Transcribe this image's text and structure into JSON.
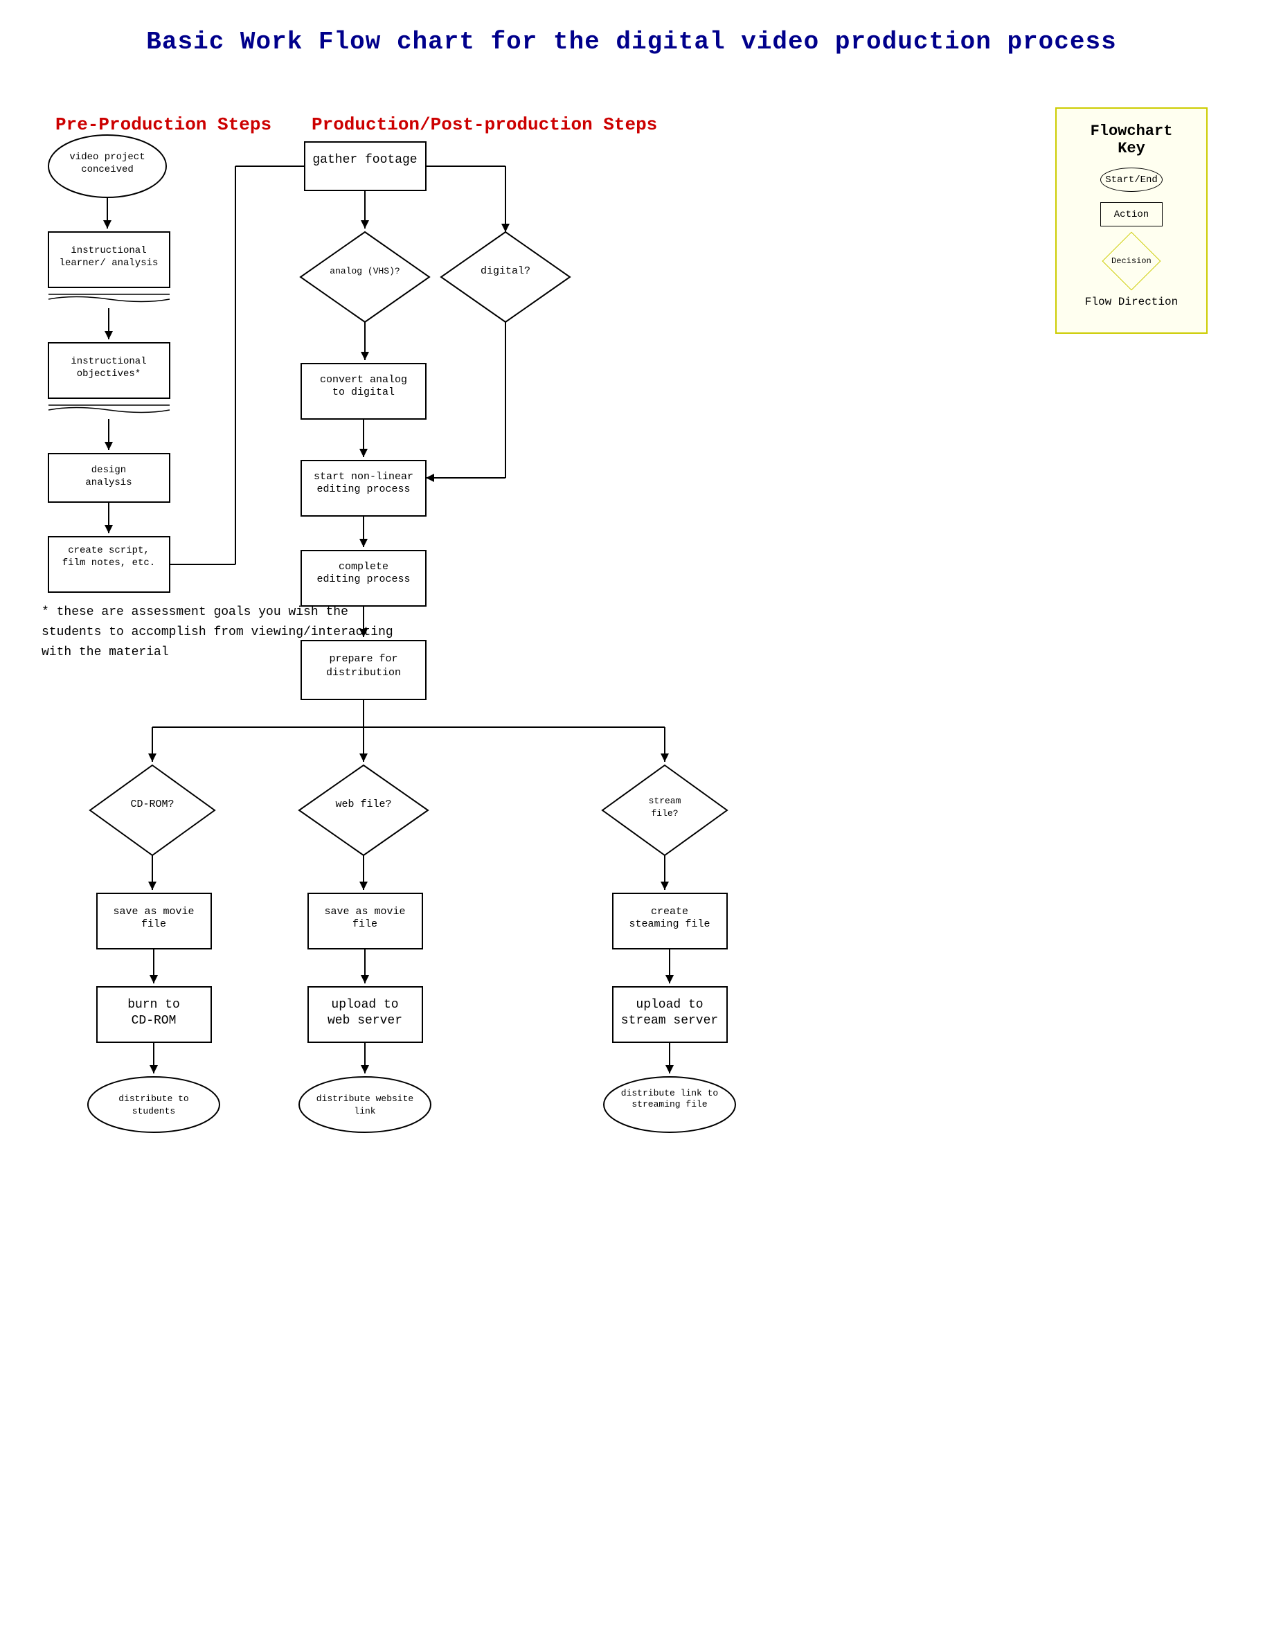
{
  "title": "Basic Work Flow chart for the digital video production process",
  "sections": {
    "pre_production": "Pre-Production Steps",
    "production": "Production/Post-production Steps"
  },
  "flowchart_key": {
    "title": "Flowchart Key",
    "start_end": "Start/End",
    "action": "Action",
    "decision": "Decision",
    "flow_direction": "Flow Direction"
  },
  "nodes": {
    "video_project": "video project conceived",
    "instructional_learner": "instructional learner/ analysis",
    "instructional_objectives": "instructional objectives*",
    "design_analysis": "design analysis",
    "create_script": "create script, film notes, etc.",
    "gather_footage": "gather footage",
    "analog_vhs": "analog (VHS)?",
    "digital": "digital?",
    "convert_analog": "convert analog to digital",
    "start_nonlinear": "start non-linear editing process",
    "complete_editing": "complete editing process",
    "prepare_distribution": "prepare for distribution",
    "cdrom_decision": "CD-ROM?",
    "web_file_decision": "web file?",
    "stream_file_decision": "stream file?",
    "save_movie_cdrom": "save as movie file",
    "save_movie_web": "save as movie file",
    "create_streaming": "create steaming file",
    "burn_cdrom": "burn to CD-ROM",
    "upload_web": "upload to web server",
    "upload_stream": "upload to stream server",
    "distribute_students": "distribute to students",
    "distribute_website": "distribute website link",
    "distribute_streaming": "distribute link to streaming file"
  },
  "annotation": "* these are assessment goals you wish the\nstudents to accomplish from viewing/interacting\nwith the material"
}
